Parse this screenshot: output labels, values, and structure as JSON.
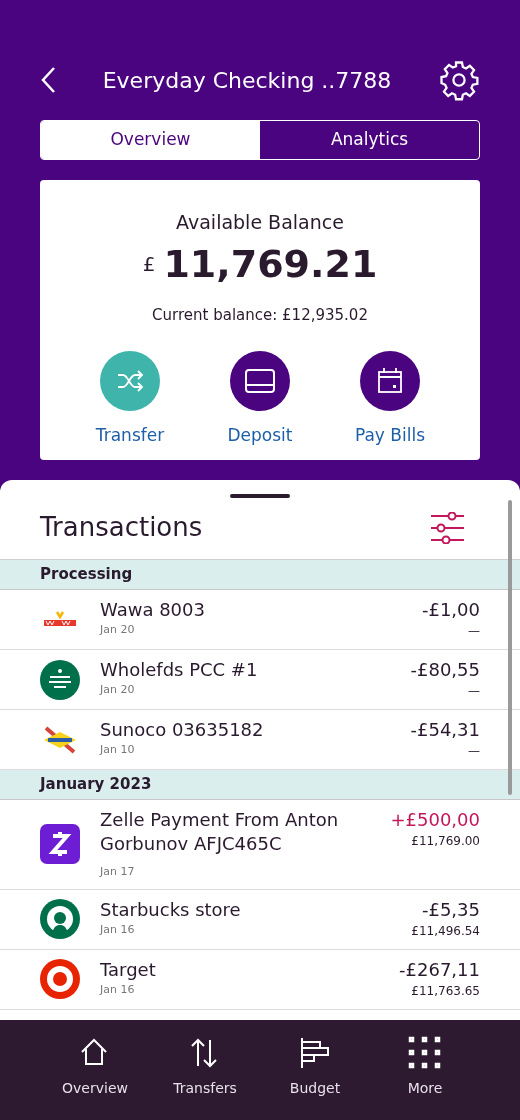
{
  "header": {
    "title": "Everyday Checking ..7788"
  },
  "tabs": [
    {
      "label": "Overview",
      "selected": true
    },
    {
      "label": "Analytics",
      "selected": false
    }
  ],
  "balance_card": {
    "label": "Available Balance",
    "currency": "£",
    "amount": "11,769.21",
    "current_balance": "Current balance: £12,935.02",
    "actions": [
      {
        "label": "Transfer",
        "kind": "transfer"
      },
      {
        "label": "Deposit",
        "kind": "deposit"
      },
      {
        "label": "Pay Bills",
        "kind": "bills"
      }
    ]
  },
  "transactions": {
    "title": "Transactions",
    "sections": [
      {
        "title": "Processing",
        "items": [
          {
            "name": "Wawa 8003",
            "date": "Jan 20",
            "amount": "-£1,00",
            "balance": "—",
            "credit": false,
            "kind": "wawa"
          },
          {
            "name": "Wholefds PCC #1",
            "date": "Jan 20",
            "amount": "-£80,55",
            "balance": "—",
            "credit": false,
            "kind": "grocer"
          },
          {
            "name": "Sunoco 03635182",
            "date": "Jan 10",
            "amount": "-£54,31",
            "balance": "—",
            "credit": false,
            "kind": "fuel"
          }
        ]
      },
      {
        "title": "January 2023",
        "items": [
          {
            "name": "Zelle Payment From Anton Gorbunov AFJC465C",
            "date": "Jan 17",
            "amount": "+£500,00",
            "balance": "£11,769.00",
            "credit": true,
            "kind": "zelle"
          },
          {
            "name": "Starbucks store",
            "date": "Jan 16",
            "amount": "-£5,35",
            "balance": "£11,496.54",
            "credit": false,
            "kind": "coffee"
          },
          {
            "name": "Target",
            "date": "Jan 16",
            "amount": "-£267,11",
            "balance": "£11,763.65",
            "credit": false,
            "kind": "target"
          }
        ]
      }
    ]
  },
  "bottom_nav": [
    {
      "label": "Overview",
      "kind": "home"
    },
    {
      "label": "Transfers",
      "kind": "transfers"
    },
    {
      "label": "Budget",
      "kind": "budget"
    },
    {
      "label": "More",
      "kind": "more"
    }
  ]
}
